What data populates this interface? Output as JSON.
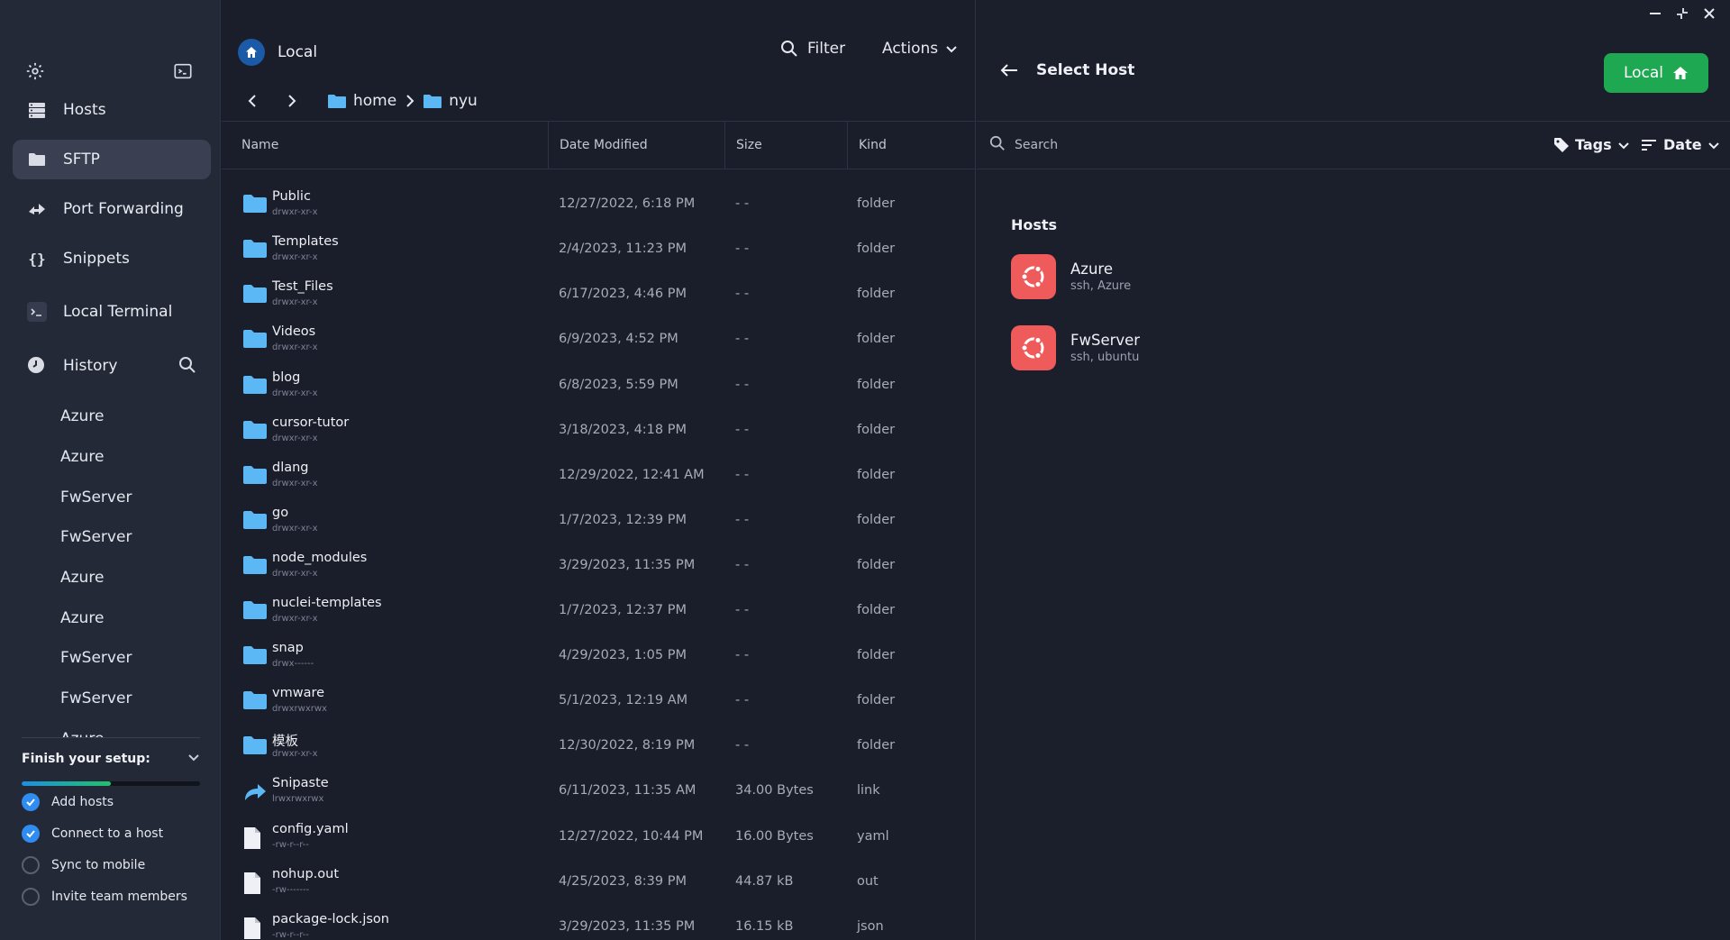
{
  "sidebar": {
    "nav": [
      {
        "label": "Hosts",
        "icon": "hosts-icon"
      },
      {
        "label": "SFTP",
        "icon": "folder-icon"
      },
      {
        "label": "Port Forwarding",
        "icon": "port-forwarding-icon"
      },
      {
        "label": "Snippets",
        "icon": "snippets-icon"
      },
      {
        "label": "Local Terminal",
        "icon": "terminal-icon"
      }
    ],
    "history_label": "History",
    "history": [
      "Azure",
      "Azure",
      "FwServer",
      "FwServer",
      "Azure",
      "Azure",
      "FwServer",
      "FwServer",
      "Azure"
    ],
    "setup": {
      "title": "Finish your setup:",
      "progress": 0.5,
      "tasks": [
        {
          "label": "Add hosts",
          "done": true
        },
        {
          "label": "Connect to a host",
          "done": true
        },
        {
          "label": "Sync to mobile",
          "done": false
        },
        {
          "label": "Invite team members",
          "done": false
        }
      ]
    }
  },
  "files": {
    "title": "Local",
    "filter_label": "Filter",
    "actions_label": "Actions",
    "breadcrumb": [
      "home",
      "nyu"
    ],
    "columns": {
      "name": "Name",
      "date": "Date Modified",
      "size": "Size",
      "kind": "Kind"
    },
    "rows": [
      {
        "name": "",
        "perm": "drwxr-xr-x",
        "date": "",
        "size": "",
        "kind": "",
        "type": "folder"
      },
      {
        "name": "Public",
        "perm": "drwxr-xr-x",
        "date": "12/27/2022, 6:18 PM",
        "size": "- -",
        "kind": "folder",
        "type": "folder"
      },
      {
        "name": "Templates",
        "perm": "drwxr-xr-x",
        "date": "2/4/2023, 11:23 PM",
        "size": "- -",
        "kind": "folder",
        "type": "folder"
      },
      {
        "name": "Test_Files",
        "perm": "drwxr-xr-x",
        "date": "6/17/2023, 4:46 PM",
        "size": "- -",
        "kind": "folder",
        "type": "folder"
      },
      {
        "name": "Videos",
        "perm": "drwxr-xr-x",
        "date": "6/9/2023, 4:52 PM",
        "size": "- -",
        "kind": "folder",
        "type": "folder"
      },
      {
        "name": "blog",
        "perm": "drwxr-xr-x",
        "date": "6/8/2023, 5:59 PM",
        "size": "- -",
        "kind": "folder",
        "type": "folder"
      },
      {
        "name": "cursor-tutor",
        "perm": "drwxr-xr-x",
        "date": "3/18/2023, 4:18 PM",
        "size": "- -",
        "kind": "folder",
        "type": "folder"
      },
      {
        "name": "dlang",
        "perm": "drwxr-xr-x",
        "date": "12/29/2022, 12:41 AM",
        "size": "- -",
        "kind": "folder",
        "type": "folder"
      },
      {
        "name": "go",
        "perm": "drwxr-xr-x",
        "date": "1/7/2023, 12:39 PM",
        "size": "- -",
        "kind": "folder",
        "type": "folder"
      },
      {
        "name": "node_modules",
        "perm": "drwxr-xr-x",
        "date": "3/29/2023, 11:35 PM",
        "size": "- -",
        "kind": "folder",
        "type": "folder"
      },
      {
        "name": "nuclei-templates",
        "perm": "drwxr-xr-x",
        "date": "1/7/2023, 12:37 PM",
        "size": "- -",
        "kind": "folder",
        "type": "folder"
      },
      {
        "name": "snap",
        "perm": "drwx------",
        "date": "4/29/2023, 1:05 PM",
        "size": "- -",
        "kind": "folder",
        "type": "folder"
      },
      {
        "name": "vmware",
        "perm": "drwxrwxrwx",
        "date": "5/1/2023, 12:19 AM",
        "size": "- -",
        "kind": "folder",
        "type": "folder"
      },
      {
        "name": "模板",
        "perm": "drwxr-xr-x",
        "date": "12/30/2022, 8:19 PM",
        "size": "- -",
        "kind": "folder",
        "type": "folder"
      },
      {
        "name": "Snipaste",
        "perm": "lrwxrwxrwx",
        "date": "6/11/2023, 11:35 AM",
        "size": "34.00 Bytes",
        "kind": "link",
        "type": "link"
      },
      {
        "name": "config.yaml",
        "perm": "-rw-r--r--",
        "date": "12/27/2022, 10:44 PM",
        "size": "16.00 Bytes",
        "kind": "yaml",
        "type": "file"
      },
      {
        "name": "nohup.out",
        "perm": "-rw-------",
        "date": "4/25/2023, 8:39 PM",
        "size": "44.87 kB",
        "kind": "out",
        "type": "file"
      },
      {
        "name": "package-lock.json",
        "perm": "-rw-r--r--",
        "date": "3/29/2023, 11:35 PM",
        "size": "16.15 kB",
        "kind": "json",
        "type": "file"
      }
    ]
  },
  "right": {
    "title": "Select Host",
    "local_button": "Local",
    "search_placeholder": "Search",
    "tags_label": "Tags",
    "date_label": "Date",
    "hosts_title": "Hosts",
    "hosts": [
      {
        "name": "Azure",
        "sub": "ssh, Azure"
      },
      {
        "name": "FwServer",
        "sub": "ssh, ubuntu"
      }
    ]
  },
  "colors": {
    "accent": "#1ea852",
    "folder": "#5cb8f5",
    "host_icon": "#ef5a5a",
    "progress_start": "#1d8fe0",
    "progress_end": "#23c16b"
  }
}
